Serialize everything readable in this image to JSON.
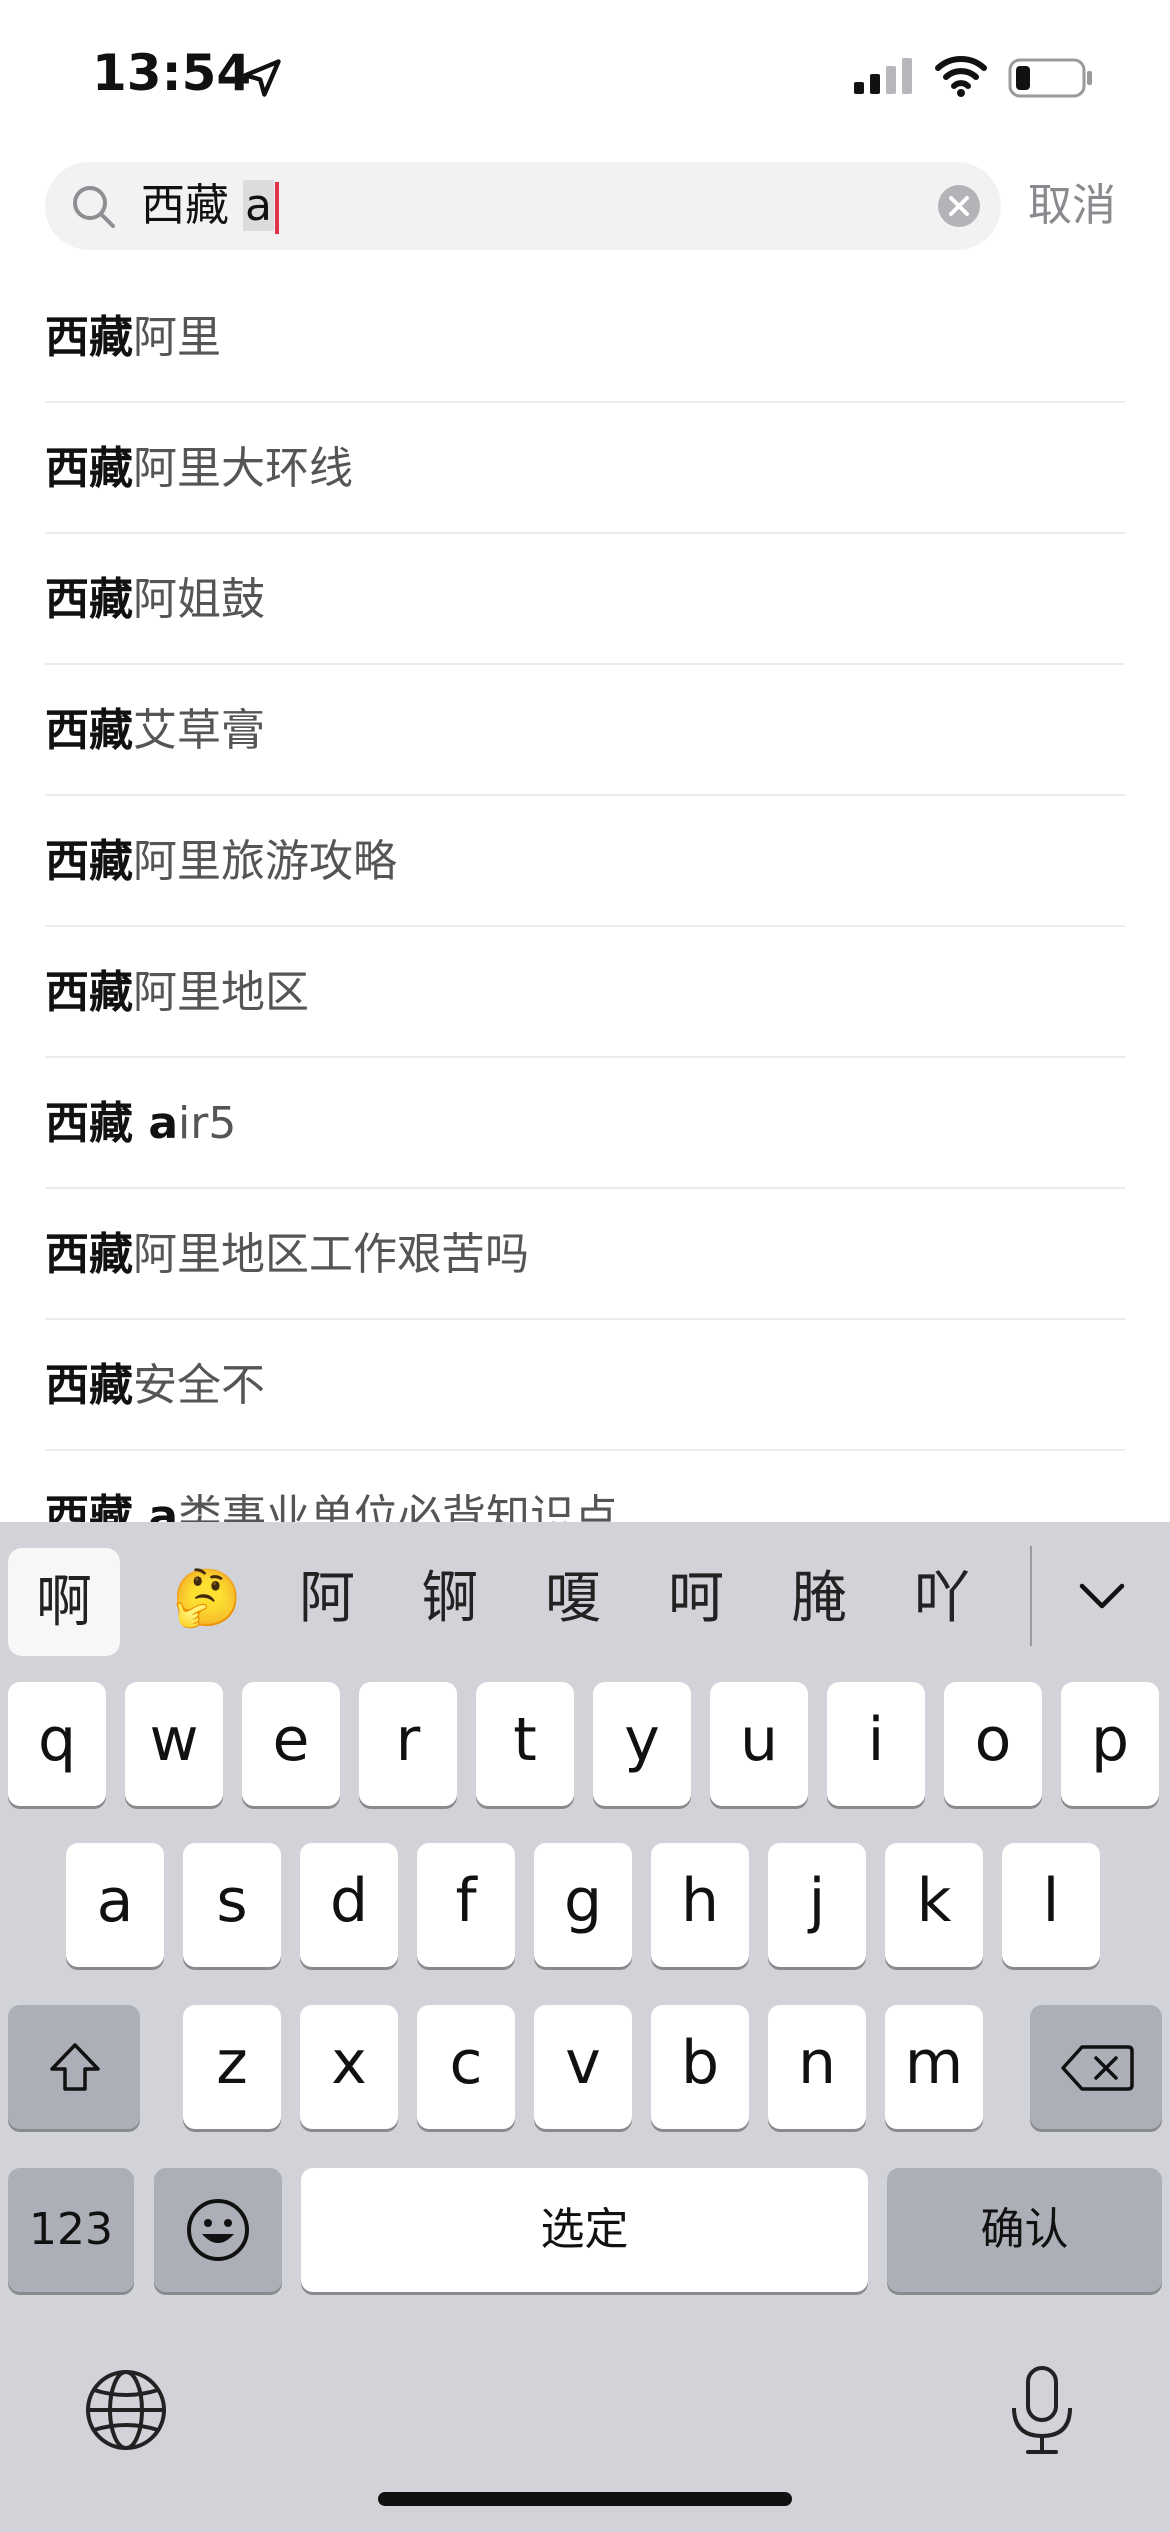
{
  "status_bar": {
    "time": "13:54",
    "icons": [
      "location-arrow-icon",
      "cellular-signal-icon",
      "wifi-icon",
      "battery-icon"
    ]
  },
  "search": {
    "query_prefix": "西藏",
    "query_typed": "a",
    "cancel_label": "取消",
    "icons": [
      "search-icon",
      "clear-icon"
    ]
  },
  "suggestions": [
    {
      "bold": "西藏",
      "rest": "阿里"
    },
    {
      "bold": "西藏",
      "rest": "阿里大环线"
    },
    {
      "bold": "西藏",
      "rest": "阿姐鼓"
    },
    {
      "bold": "西藏",
      "rest": "艾草膏"
    },
    {
      "bold": "西藏",
      "rest": "阿里旅游攻略"
    },
    {
      "bold": "西藏",
      "rest": "阿里地区"
    },
    {
      "bold": "西藏 a",
      "rest": "ir5"
    },
    {
      "bold": "西藏",
      "rest": "阿里地区工作艰苦吗"
    },
    {
      "bold": "西藏",
      "rest": "安全不"
    },
    {
      "bold": "西藏 a",
      "rest": "类事业单位必背知识点"
    }
  ],
  "keyboard": {
    "candidates": [
      "啊",
      "🤔",
      "阿",
      "锕",
      "嗄",
      "呵",
      "腌",
      "吖"
    ],
    "row1": [
      "q",
      "w",
      "e",
      "r",
      "t",
      "y",
      "u",
      "i",
      "o",
      "p"
    ],
    "row2": [
      "a",
      "s",
      "d",
      "f",
      "g",
      "h",
      "j",
      "k",
      "l"
    ],
    "row3": [
      "z",
      "x",
      "c",
      "v",
      "b",
      "n",
      "m"
    ],
    "numbers_label": "123",
    "space_label": "选定",
    "confirm_label": "确认",
    "colors": {
      "background": "#d1d3d9",
      "key": "#ffffff",
      "function_key": "#acafb8"
    },
    "icons": [
      "shift-icon",
      "delete-icon",
      "emoji-icon",
      "globe-icon",
      "microphone-icon",
      "collapse-chevron-icon"
    ]
  }
}
